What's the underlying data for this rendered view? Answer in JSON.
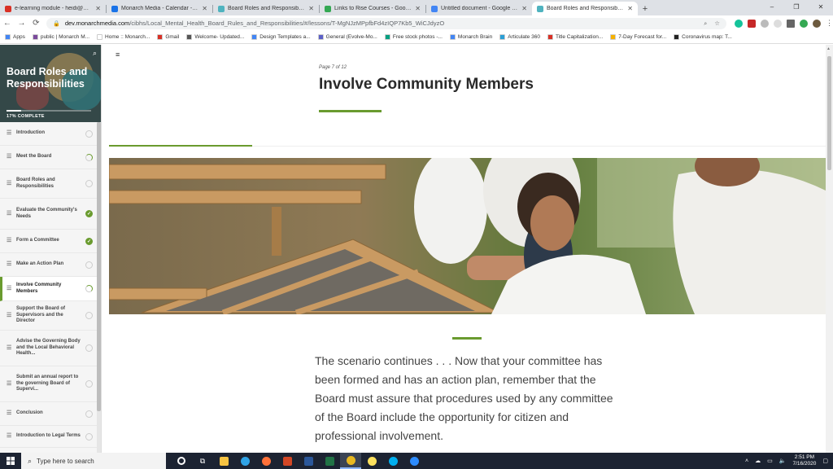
{
  "browser": {
    "tabs": [
      {
        "label": "e-learning module - heidi@mon...",
        "color": "#d93025",
        "active": false
      },
      {
        "label": "Monarch Media - Calendar - 4 d...",
        "color": "#1a73e8",
        "active": false
      },
      {
        "label": "Board Roles and Responsibilitie...",
        "color": "#4fb3bf",
        "active": false
      },
      {
        "label": "Links to Rise Courses - Google D...",
        "color": "#34a853",
        "active": false
      },
      {
        "label": "Untitled document - Google Do...",
        "color": "#4285f4",
        "active": false
      },
      {
        "label": "Board Roles and Responsibilitie...",
        "color": "#4fb3bf",
        "active": true
      }
    ],
    "new_tab": "+",
    "window_controls": {
      "minimize": "–",
      "maximize": "❐",
      "close": "✕"
    },
    "nav": {
      "back": "←",
      "forward": "→",
      "reload": "⟳"
    },
    "url_host": "dev.monarchmedia.com",
    "url_path": "/cibhs/Local_Mental_Health_Board_Rules_and_Responsibilities/#/lessons/T-MgNJzMPpfbFd4zIQP7Kb5_WiCJdyzO",
    "bookmarks": [
      {
        "label": "Apps",
        "color": "#4285f4"
      },
      {
        "label": "public | Monarch M...",
        "color": "#7b4b9c"
      },
      {
        "label": "Home :: Monarch...",
        "color": "#ffffff"
      },
      {
        "label": "Gmail",
        "color": "#d93025"
      },
      {
        "label": "Welcome- Updated...",
        "color": "#555555"
      },
      {
        "label": "Design Templates a...",
        "color": "#4285f4"
      },
      {
        "label": "General (Evolve-Mo...",
        "color": "#5b5fc7"
      },
      {
        "label": "Free stock photos -...",
        "color": "#05a081"
      },
      {
        "label": "Monarch Brain",
        "color": "#4285f4"
      },
      {
        "label": "Articulate 360",
        "color": "#2a9fd6"
      },
      {
        "label": "Title Capitalization...",
        "color": "#d93025"
      },
      {
        "label": "7-Day Forecast for...",
        "color": "#f6b100"
      },
      {
        "label": "Coronavirus map: T...",
        "color": "#222222"
      }
    ]
  },
  "sidebar": {
    "course_title": "Board Roles and Responsibilities",
    "progress_text": "17% COMPLETE",
    "progress_fraction": 0.17,
    "lessons": [
      {
        "label": "Introduction",
        "status": "none",
        "current": false
      },
      {
        "label": "Meet the Board",
        "status": "partial",
        "current": false
      },
      {
        "label": "Board Roles and Responsibilities",
        "status": "none",
        "current": false
      },
      {
        "label": "Evaluate the Community's Needs",
        "status": "done",
        "current": false
      },
      {
        "label": "Form a Committee",
        "status": "done",
        "current": false
      },
      {
        "label": "Make an Action Plan",
        "status": "none",
        "current": false
      },
      {
        "label": "Involve Community Members",
        "status": "partial",
        "current": true
      },
      {
        "label": "Support the Board of Supervisors and the Director",
        "status": "none",
        "current": false
      },
      {
        "label": "Advise the Governing Body and the Local Behavioral Health...",
        "status": "none",
        "current": false
      },
      {
        "label": "Submit an annual report to the governing Board of Supervi...",
        "status": "none",
        "current": false
      },
      {
        "label": "Conclusion",
        "status": "none",
        "current": false
      },
      {
        "label": "Introduction to Legal Terms",
        "status": "none",
        "current": false
      }
    ]
  },
  "main": {
    "page_label": "Page 7 of 12",
    "lesson_title": "Involve Community Members",
    "body_text": "The scenario continues . . . Now that your committee has been formed and has an action plan, remember that the Board must assure that procedures used by any committee of the Board include the opportunity for citizen and professional involvement.",
    "accent_color": "#6a9b2f"
  },
  "taskbar": {
    "search_placeholder": "Type here to search",
    "time": "2:51 PM",
    "date": "7/16/2020",
    "apps": [
      {
        "name": "cortana",
        "color": "#ffffff"
      },
      {
        "name": "task-view",
        "color": "#ffffff"
      },
      {
        "name": "file-explorer",
        "color": "#f6c342"
      },
      {
        "name": "edge",
        "color": "#2fa3e6"
      },
      {
        "name": "firefox",
        "color": "#ff7139"
      },
      {
        "name": "powerpoint",
        "color": "#d24726"
      },
      {
        "name": "word",
        "color": "#2b579a"
      },
      {
        "name": "excel",
        "color": "#217346"
      },
      {
        "name": "chrome",
        "color": "#e8b820"
      },
      {
        "name": "sticky-notes",
        "color": "#fce15e"
      },
      {
        "name": "skype",
        "color": "#00aff0"
      },
      {
        "name": "zoom",
        "color": "#2d8cff"
      }
    ]
  }
}
